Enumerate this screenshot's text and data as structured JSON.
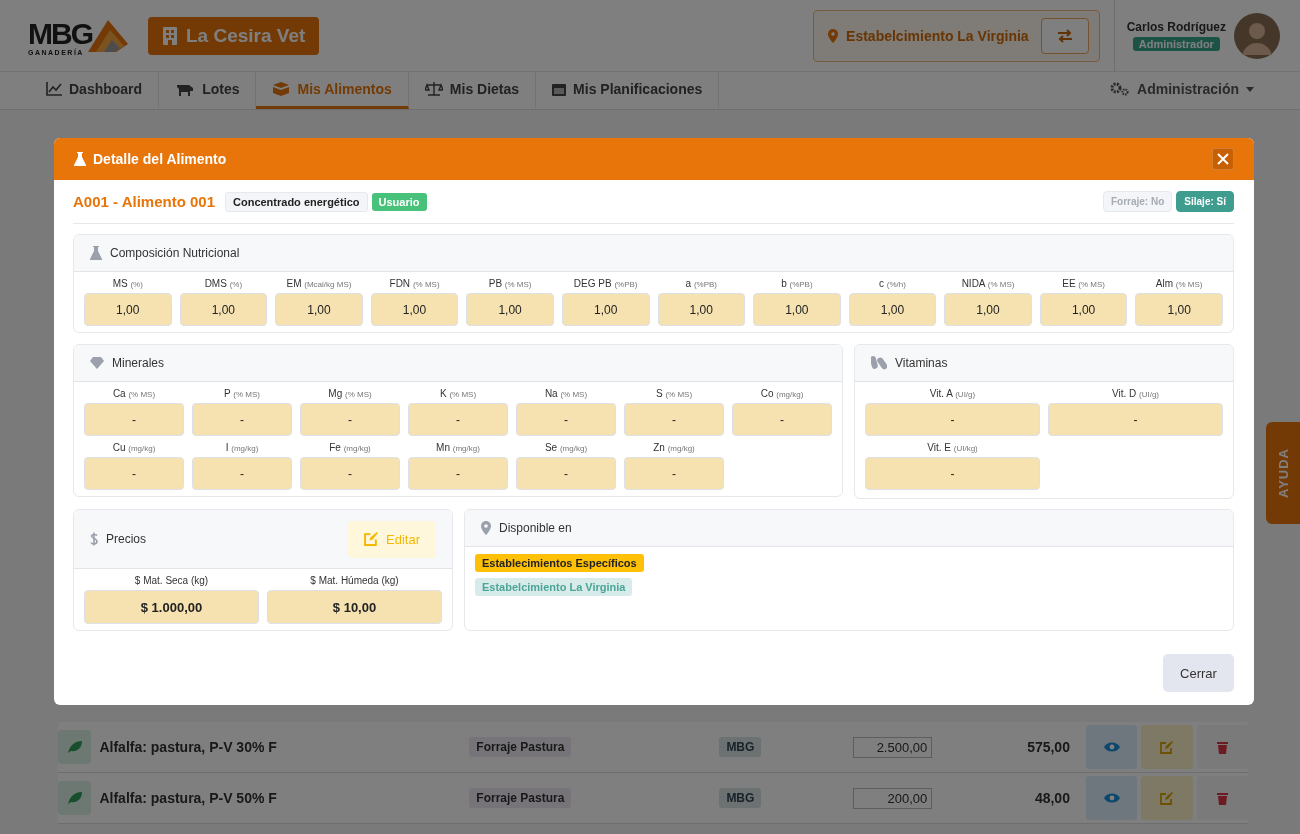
{
  "header": {
    "logo": {
      "text": "MBG",
      "subtitle": "GANADERÍA"
    },
    "clinic": "La Cesira Vet",
    "establishment": "Estabelcimiento La Virginia",
    "user": {
      "name": "Carlos Rodríguez",
      "role": "Administrador"
    }
  },
  "nav": {
    "items": [
      {
        "label": "Dashboard",
        "selected": false
      },
      {
        "label": "Lotes",
        "selected": false
      },
      {
        "label": "Mis Alimentos",
        "selected": true
      },
      {
        "label": "Mis Dietas",
        "selected": false
      },
      {
        "label": "Mis Planificaciones",
        "selected": false
      }
    ],
    "admin": "Administración"
  },
  "table_rows": [
    {
      "name": "Alfalfa: pastura, P-V 30% F",
      "category": "Forraje Pastura",
      "source": "MBG",
      "stock": "2.500,00",
      "value": "575,00"
    },
    {
      "name": "Alfalfa: pastura, P-V 50% F",
      "category": "Forraje Pastura",
      "source": "MBG",
      "stock": "200,00",
      "value": "48,00"
    }
  ],
  "help_tab": "AYUDA",
  "modal": {
    "title": "Detalle del Alimento",
    "code": "A001 - Alimento 001",
    "tags": [
      {
        "label": "Concentrado energético",
        "kind": "category"
      },
      {
        "label": "Usuario",
        "kind": "owner"
      }
    ],
    "flags": [
      {
        "label": "Forraje: No",
        "on": false
      },
      {
        "label": "Silaje: Sí",
        "on": true
      }
    ],
    "composition": {
      "title": "Composición Nutricional",
      "fields": [
        {
          "name": "MS",
          "unit": "(%)",
          "value": "1,00"
        },
        {
          "name": "DMS",
          "unit": "(%)",
          "value": "1,00"
        },
        {
          "name": "EM",
          "unit": "(Mcal/kg MS)",
          "value": "1,00"
        },
        {
          "name": "FDN",
          "unit": "(% MS)",
          "value": "1,00"
        },
        {
          "name": "PB",
          "unit": "(% MS)",
          "value": "1,00"
        },
        {
          "name": "DEG PB",
          "unit": "(%PB)",
          "value": "1,00"
        },
        {
          "name": "a",
          "unit": "(%PB)",
          "value": "1,00"
        },
        {
          "name": "b",
          "unit": "(%PB)",
          "value": "1,00"
        },
        {
          "name": "c",
          "unit": "(%/h)",
          "value": "1,00"
        },
        {
          "name": "NIDA",
          "unit": "(% MS)",
          "value": "1,00"
        },
        {
          "name": "EE",
          "unit": "(% MS)",
          "value": "1,00"
        },
        {
          "name": "Alm",
          "unit": "(% MS)",
          "value": "1,00"
        }
      ]
    },
    "minerals": {
      "title": "Minerales",
      "fields": [
        {
          "name": "Ca",
          "unit": "(% MS)",
          "value": "-"
        },
        {
          "name": "P",
          "unit": "(% MS)",
          "value": "-"
        },
        {
          "name": "Mg",
          "unit": "(% MS)",
          "value": "-"
        },
        {
          "name": "K",
          "unit": "(% MS)",
          "value": "-"
        },
        {
          "name": "Na",
          "unit": "(% MS)",
          "value": "-"
        },
        {
          "name": "S",
          "unit": "(% MS)",
          "value": "-"
        },
        {
          "name": "Co",
          "unit": "(mg/kg)",
          "value": "-"
        },
        {
          "name": "Cu",
          "unit": "(mg/kg)",
          "value": "-"
        },
        {
          "name": "I",
          "unit": "(mg/kg)",
          "value": "-"
        },
        {
          "name": "Fe",
          "unit": "(mg/kg)",
          "value": "-"
        },
        {
          "name": "Mn",
          "unit": "(mg/kg)",
          "value": "-"
        },
        {
          "name": "Se",
          "unit": "(mg/kg)",
          "value": "-"
        },
        {
          "name": "Zn",
          "unit": "(mg/kg)",
          "value": "-"
        }
      ]
    },
    "vitamins": {
      "title": "Vitaminas",
      "fields": [
        {
          "name": "Vit. A",
          "unit": "(UI/g)",
          "value": "-"
        },
        {
          "name": "Vit. D",
          "unit": "(UI/g)",
          "value": "-"
        },
        {
          "name": "Vit. E",
          "unit": "(UI/kg)",
          "value": "-"
        }
      ]
    },
    "prices": {
      "title": "Precios",
      "edit_label": "Editar",
      "fields": [
        {
          "name": "$ Mat. Seca (kg)",
          "value": "$ 1.000,00"
        },
        {
          "name": "$ Mat. Húmeda (kg)",
          "value": "$ 10,00"
        }
      ]
    },
    "available": {
      "title": "Disponible en",
      "tags": [
        {
          "label": "Establecimientos Específicos",
          "kind": "scope"
        },
        {
          "label": "Estabelcimiento La Virginia",
          "kind": "place"
        }
      ]
    },
    "close_label": "Cerrar"
  }
}
